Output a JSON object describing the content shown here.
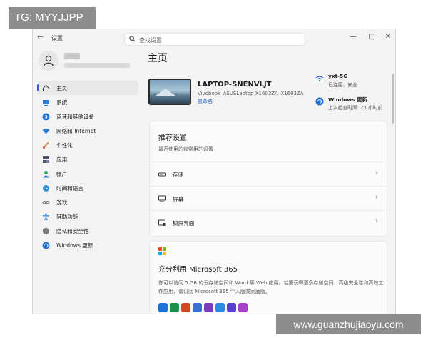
{
  "tag_badge": "TG: MYYJJPP",
  "watermark": "www.guanzhujiaoyu.com",
  "window": {
    "app_title": "设置",
    "back_icon": "back-arrow-icon",
    "controls": [
      "—",
      "▢",
      "✕"
    ],
    "search_placeholder": "查找设置"
  },
  "user": {
    "avatar_icon": "person-icon"
  },
  "sidebar": {
    "items": [
      {
        "label": "主页",
        "icon": "home-icon",
        "active": true
      },
      {
        "label": "系统",
        "icon": "system-icon"
      },
      {
        "label": "蓝牙和其他设备",
        "icon": "bluetooth-icon"
      },
      {
        "label": "网络和 Internet",
        "icon": "wifi-icon"
      },
      {
        "label": "个性化",
        "icon": "brush-icon"
      },
      {
        "label": "应用",
        "icon": "apps-icon"
      },
      {
        "label": "帐户",
        "icon": "account-icon"
      },
      {
        "label": "时间和语言",
        "icon": "globe-clock-icon"
      },
      {
        "label": "游戏",
        "icon": "gamepad-icon"
      },
      {
        "label": "辅助功能",
        "icon": "accessibility-icon"
      },
      {
        "label": "隐私和安全性",
        "icon": "shield-icon"
      },
      {
        "label": "Windows 更新",
        "icon": "update-icon"
      }
    ]
  },
  "main": {
    "title": "主页",
    "device": {
      "name": "LAPTOP-SNENVLJT",
      "model": "Vivobook_ASUSLaptop X1603ZA_X1603ZA",
      "rename": "重命名"
    },
    "status": [
      {
        "title": "yxt-5G",
        "sub": "已连接，安全",
        "icon": "wifi-icon"
      },
      {
        "title": "Windows 更新",
        "sub": "上次检查时间: 23 小时前",
        "icon": "update-icon"
      }
    ],
    "recommended": {
      "title": "推荐设置",
      "subtitle": "最近使用的和常用的设置",
      "rows": [
        {
          "label": "存储",
          "icon": "storage-icon"
        },
        {
          "label": "屏幕",
          "icon": "display-icon"
        },
        {
          "label": "锁屏界面",
          "icon": "lock-screen-icon"
        }
      ]
    },
    "m365": {
      "title": "充分利用 Microsoft 365",
      "desc": "你可以访问 5 GB 的云存储空间和 Word 等 Web 应用。若要获得更多存储空间、高级安全性和高效工作应用，请订阅 Microsoft 365 个人版或家庭版。"
    }
  }
}
